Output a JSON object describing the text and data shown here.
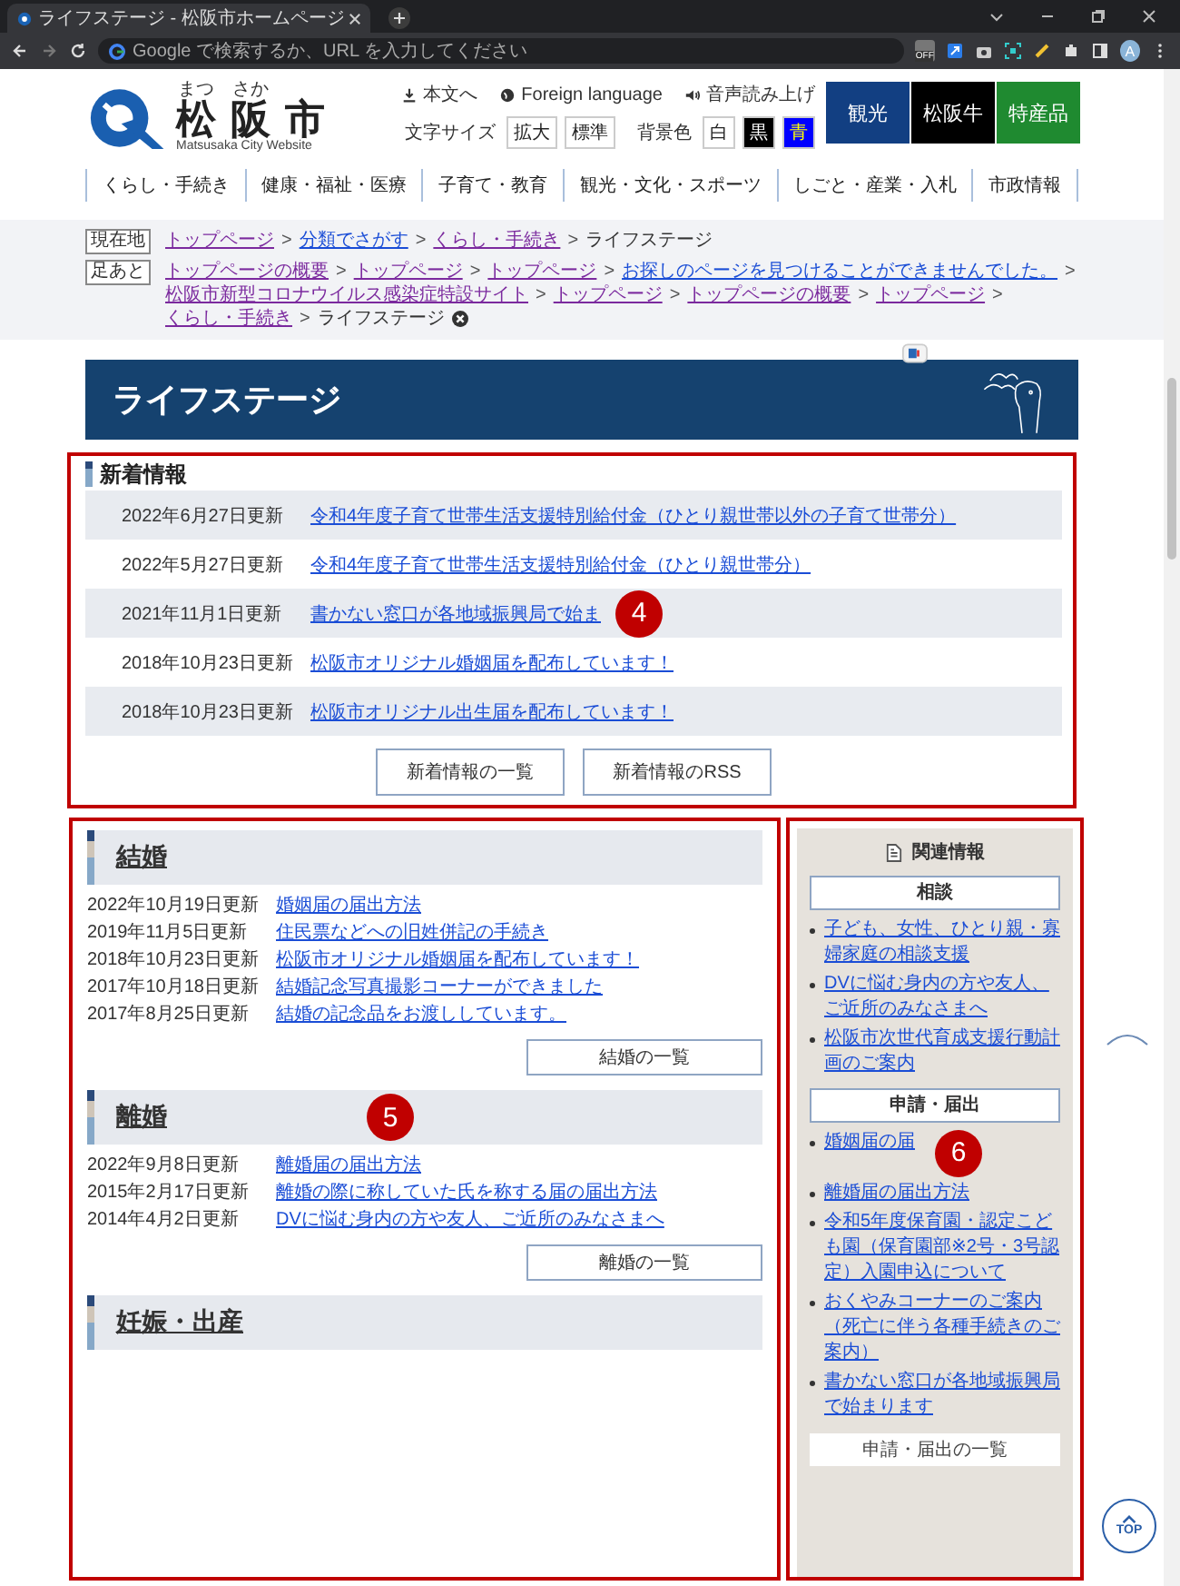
{
  "browser": {
    "tab_title": "ライフステージ - 松阪市ホームページ",
    "address_placeholder": "Google で検索するか、URL を入力してください",
    "extension_badge": "OFF",
    "avatar_letter": "A"
  },
  "header": {
    "logo_name": [
      "松",
      "阪",
      "市"
    ],
    "logo_ruby": [
      "まつ",
      "さか"
    ],
    "logo_en": "Matsusaka City Website",
    "utility_links": [
      {
        "kind": "download",
        "label": "本文へ"
      },
      {
        "kind": "globe",
        "label": "Foreign language"
      },
      {
        "kind": "speaker",
        "label": "音声読み上げ"
      }
    ],
    "font_size": {
      "label": "文字サイズ",
      "buttons": [
        "拡大",
        "標準"
      ]
    },
    "bg_color": {
      "label": "背景色",
      "options": [
        {
          "label": "白",
          "color": "#ffffff"
        },
        {
          "label": "黒",
          "color": "#000000"
        },
        {
          "label": "青",
          "color": "#0000ff"
        }
      ]
    },
    "tiles": [
      {
        "label": "観光",
        "color": "#123f82"
      },
      {
        "label": "松阪牛",
        "color": "#000000"
      },
      {
        "label": "特産品",
        "color": "#1f8a30"
      }
    ]
  },
  "nav": [
    "くらし・手続き",
    "健康・福祉・医療",
    "子育て・教育",
    "観光・文化・スポーツ",
    "しごと・産業・入札",
    "市政情報"
  ],
  "breadcrumbs": [
    {
      "tag": "現在地",
      "items": [
        {
          "label": "トップページ",
          "kind": "visited"
        },
        {
          "separator": ">",
          "label": "分類でさがす",
          "kind": "link"
        },
        {
          "separator": ">",
          "label": "くらし・手続き",
          "kind": "visited"
        },
        {
          "separator": ">",
          "label": "ライフステージ",
          "kind": "current"
        }
      ]
    },
    {
      "tag": "足あと",
      "items": [
        {
          "label": "トップページの概要",
          "kind": "visited"
        },
        {
          "separator": ">",
          "label": "トップページ",
          "kind": "visited"
        },
        {
          "separator": ">",
          "label": "トップページ",
          "kind": "visited"
        },
        {
          "separator": ">",
          "label": "お探しのページを見つけることができませんでした。",
          "kind": "link"
        },
        {
          "separator": ">",
          "label": "松阪市新型コロナウイルス感染症特設サイト",
          "kind": "visited"
        },
        {
          "separator": ">",
          "label": "トップページ",
          "kind": "visited"
        },
        {
          "separator": ">",
          "label": "トップページの概要",
          "kind": "visited"
        },
        {
          "separator": ">",
          "label": "トップページ",
          "kind": "visited"
        },
        {
          "separator": ">",
          "label": "くらし・手続き",
          "kind": "visited"
        },
        {
          "separator": ">",
          "label": "ライフステージ",
          "kind": "current"
        }
      ]
    }
  ],
  "banner": {
    "title": "ライフステージ"
  },
  "news": {
    "title": "新着情報",
    "annotation": "4",
    "items": [
      {
        "date": "2022年6月27日更新",
        "title": "令和4年度子育て世帯生活支援特別給付金（ひとり親世帯以外の子育て世帯分）"
      },
      {
        "date": "2022年5月27日更新",
        "title": "令和4年度子育て世帯生活支援特別給付金（ひとり親世帯分）"
      },
      {
        "date": "2021年11月1日更新",
        "title": "書かない窓口が各地域振興局で始ま"
      },
      {
        "date": "2018年10月23日更新",
        "title": "松阪市オリジナル婚姻届を配布しています！"
      },
      {
        "date": "2018年10月23日更新",
        "title": "松阪市オリジナル出生届を配布しています！"
      }
    ],
    "buttons": [
      "新着情報の一覧",
      "新着情報のRSS"
    ]
  },
  "categories": {
    "annotation": "5",
    "sections": [
      {
        "title": "結婚",
        "entries": [
          {
            "date": "2022年10月19日更新",
            "title": "婚姻届の届出方法"
          },
          {
            "date": "2019年11月5日更新",
            "title": "住民票などへの旧姓併記の手続き"
          },
          {
            "date": "2018年10月23日更新",
            "title": "松阪市オリジナル婚姻届を配布しています！"
          },
          {
            "date": "2017年10月18日更新",
            "title": "結婚記念写真撮影コーナーができました"
          },
          {
            "date": "2017年8月25日更新",
            "title": "結婚の記念品をお渡ししています。"
          }
        ],
        "more": "結婚の一覧"
      },
      {
        "title": "離婚",
        "entries": [
          {
            "date": "2022年9月8日更新",
            "title": "離婚届の届出方法"
          },
          {
            "date": "2015年2月17日更新",
            "title": "離婚の際に称していた氏を称する届の届出方法"
          },
          {
            "date": "2014年4月2日更新",
            "title": "DVに悩む身内の方や友人、ご近所のみなさまへ"
          }
        ],
        "more": "離婚の一覧"
      },
      {
        "title": "妊娠・出産"
      }
    ]
  },
  "sidebar": {
    "title": "関連情報",
    "annotation": "6",
    "groups": [
      {
        "title": "相談",
        "links": [
          "子ども、女性、ひとり親・寡婦家庭の相談支援",
          "DVに悩む身内の方や友人、ご近所のみなさまへ",
          "松阪市次世代育成支援行動計画のご案内"
        ]
      },
      {
        "title": "申請・届出",
        "links": [
          "婚姻届の届",
          "離婚届の届出方法",
          "令和5年度保育園・認定こども園（保育園部※2号・3号認定）入園申込について",
          "おくやみコーナーのご案内（死亡に伴う各種手続きのご案内）",
          "書かない窓口が各地域振興局で始まります"
        ]
      }
    ],
    "more": "申請・届出の一覧"
  },
  "page_top": {
    "label": "TOP"
  }
}
